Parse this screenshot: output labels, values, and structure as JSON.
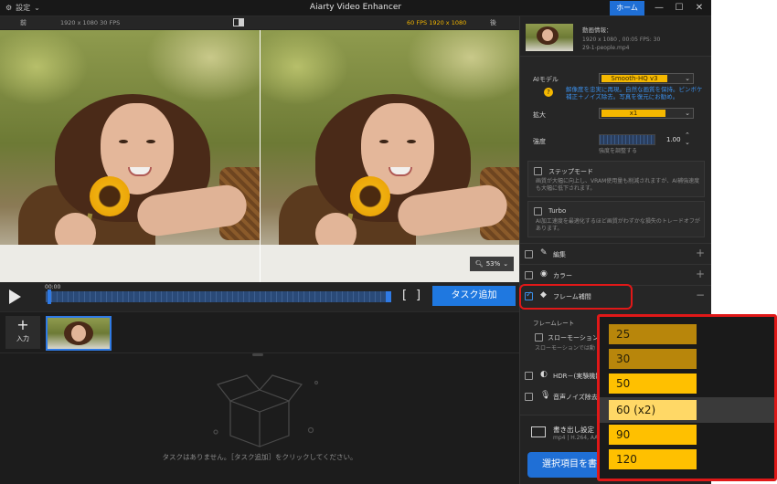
{
  "titlebar": {
    "settings_label": "設定",
    "title": "Aiarty Video Enhancer",
    "home_label": "ホーム"
  },
  "compare": {
    "left_label": "前",
    "left_info": "1920 x 1080  30 FPS",
    "right_info": "60 FPS  1920 x 1080",
    "right_label": "後",
    "zoom_value": "53%"
  },
  "playbar": {
    "time": "00:00",
    "task_add_label": "タスク追加"
  },
  "clips": {
    "add_label": "入力"
  },
  "empty_message": "タスクはありません。［タスク追加］をクリックしてください。",
  "panel": {
    "info_title": "動画情報：",
    "info_line1": "1920 x 1080 , 00:05  FPS: 30",
    "info_line2": "29-1-people.mp4",
    "ai_model_label": "AIモデル",
    "ai_model_value": "Smooth-HQ  v3",
    "ai_model_hint": "解像度を忠実に再現。自然な画質を保持。ピンボケ補正＋ノイズ除去。写真を復元にお勧め。",
    "scale_label": "拡大",
    "scale_value": "x1",
    "strength_label": "強度",
    "strength_value": "1.00",
    "strength_hint": "強度を調整する",
    "step_mode_label": "ステップモード",
    "step_mode_desc": "画質が大幅に向上し、VRAM使用量も削減されますが、AI補強速度も大幅に低下されます。",
    "turbo_label": "Turbo",
    "turbo_desc": "AI加工速度を最適化するほど画質がわずかな損失のトレードオフがあります。",
    "sections": [
      {
        "label": "編集",
        "icon": "edit-icon"
      },
      {
        "label": "カラー",
        "icon": "palette-icon"
      },
      {
        "label": "フレーム補間",
        "icon": "frame-interp-icon"
      }
    ],
    "frame_rate_label": "フレームレート",
    "slow_motion_label": "スローモーション",
    "slow_motion_desc": "スローモーションでは動",
    "hdr_label": "HDR－(実験機能)",
    "denoise_label": "音声ノイズ除去",
    "export_title": "書き出し設定",
    "export_sub": "mp4 | H.264, AA",
    "export_button": "選択項目を書き"
  },
  "fps_options": [
    {
      "label": "25",
      "style": "dim"
    },
    {
      "label": "30",
      "style": "dim"
    },
    {
      "label": "50",
      "style": "bright"
    },
    {
      "label": "60 (x2)",
      "style": "hl"
    },
    {
      "label": "90",
      "style": "bright"
    },
    {
      "label": "120",
      "style": "bright"
    }
  ],
  "colors": {
    "accent_blue": "#1f78e0",
    "accent_yellow": "#ffc000",
    "highlight_red": "#e01818"
  }
}
